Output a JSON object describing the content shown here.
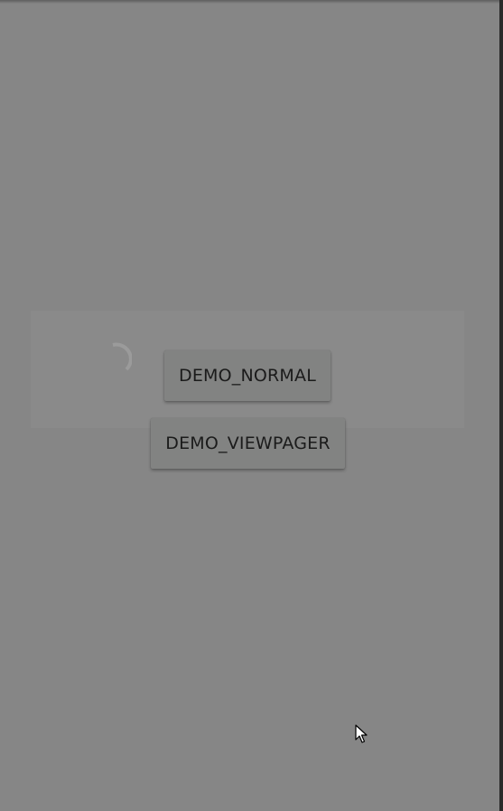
{
  "buttons": {
    "demo_normal": "DEMO_NORMAL",
    "demo_viewpager": "DEMO_VIEWPAGER"
  },
  "icons": {
    "spinner": "loading-spinner-icon",
    "cursor": "mouse-pointer-icon"
  },
  "colors": {
    "background": "#868686",
    "button": "#828382",
    "button_text": "#1b1b1b"
  }
}
